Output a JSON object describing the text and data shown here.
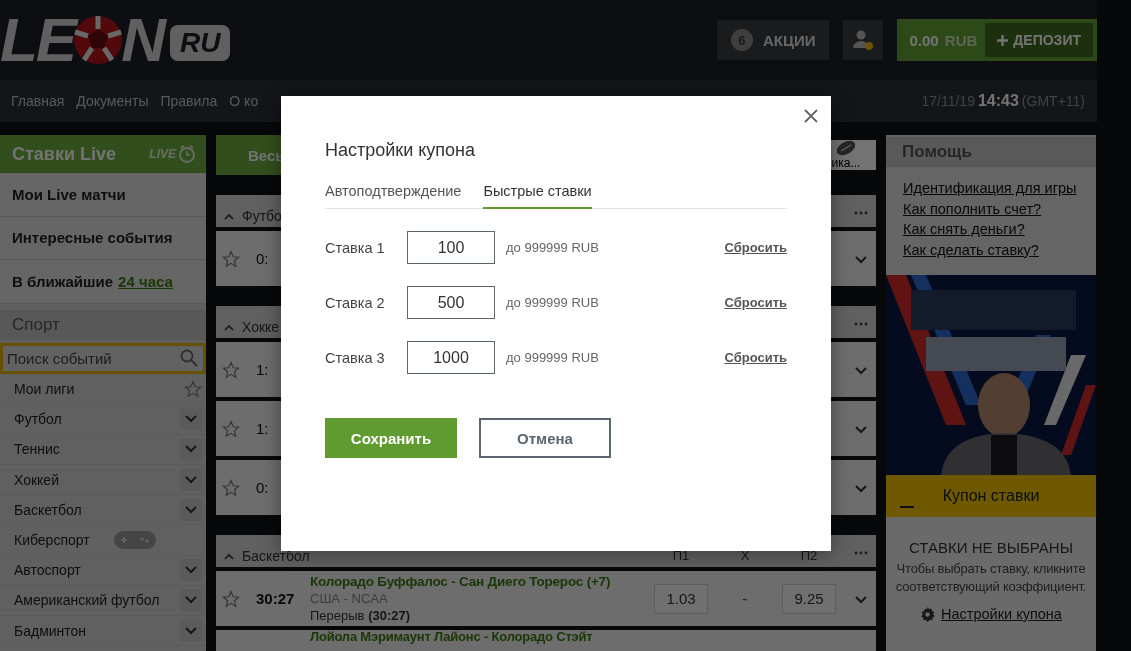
{
  "header": {
    "logo": {
      "before": "LE",
      "after": "N",
      "badge": "RU"
    },
    "promo": {
      "count": "6",
      "label": "АКЦИИ"
    },
    "account": {
      "has_notification": true
    },
    "balance": {
      "amount": "0.00",
      "currency": "RUB"
    },
    "deposit": {
      "label": "ДЕПОЗИТ"
    }
  },
  "nav": {
    "items": [
      "Главная",
      "Документы",
      "Правила",
      "О ко"
    ],
    "date": "17/11/19",
    "time": "14:43",
    "zone": "(GMT+11)"
  },
  "sidebar": {
    "live_title": "Ставки Live",
    "live_badge": "LIVE",
    "items": [
      {
        "text": "Мои Live матчи"
      },
      {
        "text": "Интересные события"
      },
      {
        "text": "В ближайшие",
        "link": "24 часа"
      }
    ],
    "sport_title": "Спорт",
    "search": {
      "placeholder": "Поиск событий"
    },
    "sports": [
      {
        "label": "Мои лиги",
        "kind": "star"
      },
      {
        "label": "Футбол",
        "kind": "chevron"
      },
      {
        "label": "Теннис",
        "kind": "chevron"
      },
      {
        "label": "Хоккей",
        "kind": "chevron"
      },
      {
        "label": "Баскетбол",
        "kind": "chevron"
      },
      {
        "label": "Киберспорт",
        "kind": "gamepad"
      },
      {
        "label": "Автоспорт",
        "kind": "chevron"
      },
      {
        "label": "Американский футбол",
        "kind": "chevron"
      },
      {
        "label": "Бадминтон",
        "kind": "chevron"
      }
    ]
  },
  "center": {
    "filter": {
      "label": "Весь"
    },
    "stats_label": "ика...",
    "sections": [
      {
        "title": "Футбо",
        "rows": [
          {
            "score": "0:"
          }
        ]
      },
      {
        "title": "Хокке",
        "rows": [
          {
            "score": "1:"
          },
          {
            "score": "1:"
          },
          {
            "score": "0:"
          }
        ]
      },
      {
        "title": "Баскетбол",
        "columns": [
          "П1",
          "X",
          "П2"
        ],
        "rows": [
          {
            "time": "30:27",
            "teams": "Колорадо Буффалос - Сан Диего Торерос (+7)",
            "league": "США - NCAA",
            "status": "Перерыв **(30:27)**",
            "odds": [
              "1.03",
              "-",
              "9.25"
            ]
          },
          {
            "teams": "Лойола Мэримаунт Лайонс - Колорадо Стэйт"
          }
        ]
      }
    ]
  },
  "help": {
    "title": "Помощь",
    "links": [
      "Идентификация для игры",
      "Как пополнить счет?",
      "Как снять деньги?",
      "Как сделать ставку?"
    ]
  },
  "coupon": {
    "title": "Купон ставки",
    "empty_title": "СТАВКИ НЕ ВЫБРАНЫ",
    "empty_text": "Чтобы выбрать ставку, кликните соответствующий коэффициент.",
    "settings_link": "Настройки купона"
  },
  "modal": {
    "title": "Настройки купона",
    "tabs": [
      {
        "label": "Автоподтверждение",
        "selected": false
      },
      {
        "label": "Быстрые ставки",
        "selected": true
      }
    ],
    "stakes": [
      {
        "label": "Ставка 1",
        "value": "100",
        "limit": "до 999999 RUB",
        "reset": "Сбросить"
      },
      {
        "label": "Ставка 2",
        "value": "500",
        "limit": "до 999999 RUB",
        "reset": "Сбросить"
      },
      {
        "label": "Ставка 3",
        "value": "1000",
        "limit": "до 999999 RUB",
        "reset": "Сбросить"
      }
    ],
    "save": "Сохранить",
    "cancel": "Отмена"
  }
}
